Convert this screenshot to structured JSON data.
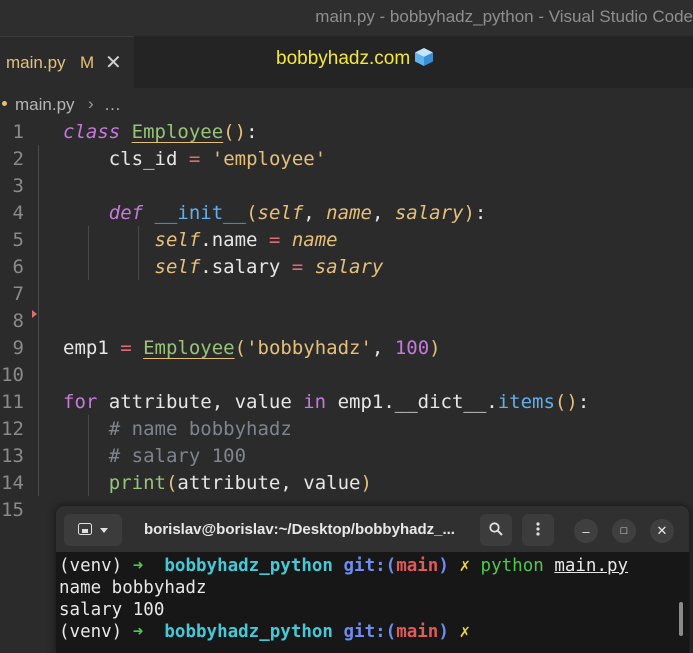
{
  "window": {
    "title": "main.py - bobbyhadz_python - Visual Studio Code"
  },
  "tabs": [
    {
      "name": "main.py",
      "modified": "M",
      "close": "✕"
    }
  ],
  "banner": {
    "text": "bobbyhadz.com",
    "icon": "ice-cube-icon"
  },
  "breadcrumb": {
    "file": "main.py",
    "separator": "›",
    "more": "…"
  },
  "editor": {
    "line_numbers": [
      "1",
      "2",
      "3",
      "4",
      "5",
      "6",
      "7",
      "8",
      "9",
      "10",
      "11",
      "12",
      "13",
      "14",
      "15"
    ],
    "lines": [
      [
        {
          "t": "kwi",
          "v": "class"
        },
        {
          "t": "pl",
          "v": " "
        },
        {
          "t": "cls",
          "v": "Employee"
        },
        {
          "t": "str",
          "v": "()"
        },
        {
          "t": "pl",
          "v": ":"
        }
      ],
      [
        {
          "t": "pl",
          "v": "    cls_id "
        },
        {
          "t": "op",
          "v": "="
        },
        {
          "t": "pl",
          "v": " "
        },
        {
          "t": "str",
          "v": "'employee'"
        }
      ],
      [],
      [
        {
          "t": "pl",
          "v": "    "
        },
        {
          "t": "kwi",
          "v": "def"
        },
        {
          "t": "pl",
          "v": " "
        },
        {
          "t": "fn",
          "v": "__init__"
        },
        {
          "t": "str",
          "v": "("
        },
        {
          "t": "par",
          "v": "self"
        },
        {
          "t": "pl",
          "v": ", "
        },
        {
          "t": "par",
          "v": "name"
        },
        {
          "t": "pl",
          "v": ", "
        },
        {
          "t": "par",
          "v": "salary"
        },
        {
          "t": "str",
          "v": ")"
        },
        {
          "t": "pl",
          "v": ":"
        }
      ],
      [
        {
          "t": "pl",
          "v": "        "
        },
        {
          "t": "par",
          "v": "self"
        },
        {
          "t": "pl",
          "v": ".name "
        },
        {
          "t": "op",
          "v": "="
        },
        {
          "t": "pl",
          "v": " "
        },
        {
          "t": "par",
          "v": "name"
        }
      ],
      [
        {
          "t": "pl",
          "v": "        "
        },
        {
          "t": "par",
          "v": "self"
        },
        {
          "t": "pl",
          "v": ".salary "
        },
        {
          "t": "op",
          "v": "="
        },
        {
          "t": "pl",
          "v": " "
        },
        {
          "t": "par",
          "v": "salary"
        }
      ],
      [],
      [],
      [
        {
          "t": "pl",
          "v": "emp1 "
        },
        {
          "t": "op",
          "v": "="
        },
        {
          "t": "pl",
          "v": " "
        },
        {
          "t": "cls",
          "v": "Employee"
        },
        {
          "t": "str",
          "v": "("
        },
        {
          "t": "str",
          "v": "'bobbyhadz'"
        },
        {
          "t": "pl",
          "v": ", "
        },
        {
          "t": "num",
          "v": "100"
        },
        {
          "t": "str",
          "v": ")"
        }
      ],
      [],
      [
        {
          "t": "kw",
          "v": "for"
        },
        {
          "t": "pl",
          "v": " attribute, value "
        },
        {
          "t": "kw",
          "v": "in"
        },
        {
          "t": "pl",
          "v": " emp1.__dict__."
        },
        {
          "t": "fn",
          "v": "items"
        },
        {
          "t": "str",
          "v": "()"
        },
        {
          "t": "pl",
          "v": ":"
        }
      ],
      [
        {
          "t": "pl",
          "v": "    "
        },
        {
          "t": "com",
          "v": "# name bobbyhadz"
        }
      ],
      [
        {
          "t": "pl",
          "v": "    "
        },
        {
          "t": "com",
          "v": "# salary 100"
        }
      ],
      [
        {
          "t": "pl",
          "v": "    "
        },
        {
          "t": "bi",
          "v": "print"
        },
        {
          "t": "str",
          "v": "("
        },
        {
          "t": "pl",
          "v": "attribute, value"
        },
        {
          "t": "str",
          "v": ")"
        }
      ],
      []
    ]
  },
  "terminal": {
    "title": "borislav@borislav:~/Desktop/bobbyhadz_...",
    "new_tab_icon": "terminal-tab-icon",
    "dropdown_icon": "chevron-down-icon",
    "search_icon": "search-icon",
    "menu_icon": "kebab-menu-icon",
    "minimize": "–",
    "maximize": "□",
    "close": "✕",
    "lines": [
      [
        {
          "c": "pl",
          "v": "(venv) "
        },
        {
          "c": "green",
          "v": "➜"
        },
        {
          "c": "pl",
          "v": "  "
        },
        {
          "c": "cyan",
          "v": "bobbyhadz_python"
        },
        {
          "c": "pl",
          "v": " "
        },
        {
          "c": "blue",
          "v": "git:("
        },
        {
          "c": "red",
          "v": "main"
        },
        {
          "c": "blue",
          "v": ")"
        },
        {
          "c": "pl",
          "v": " "
        },
        {
          "c": "yel",
          "v": "✗"
        },
        {
          "c": "pl",
          "v": " "
        },
        {
          "c": "py",
          "v": "python"
        },
        {
          "c": "pl",
          "v": " "
        },
        {
          "c": "ul",
          "v": "main.py"
        }
      ],
      [
        {
          "c": "pl",
          "v": "name bobbyhadz"
        }
      ],
      [
        {
          "c": "pl",
          "v": "salary 100"
        }
      ],
      [
        {
          "c": "pl",
          "v": "(venv) "
        },
        {
          "c": "green",
          "v": "➜"
        },
        {
          "c": "pl",
          "v": "  "
        },
        {
          "c": "cyan",
          "v": "bobbyhadz_python"
        },
        {
          "c": "pl",
          "v": " "
        },
        {
          "c": "blue",
          "v": "git:("
        },
        {
          "c": "red",
          "v": "main"
        },
        {
          "c": "blue",
          "v": ")"
        },
        {
          "c": "pl",
          "v": " "
        },
        {
          "c": "yel",
          "v": "✗"
        }
      ]
    ]
  },
  "colors": {
    "editor_bg": "#2b2b2b",
    "terminal_bg": "#171717",
    "accent_yellow": "#e5c07b"
  }
}
